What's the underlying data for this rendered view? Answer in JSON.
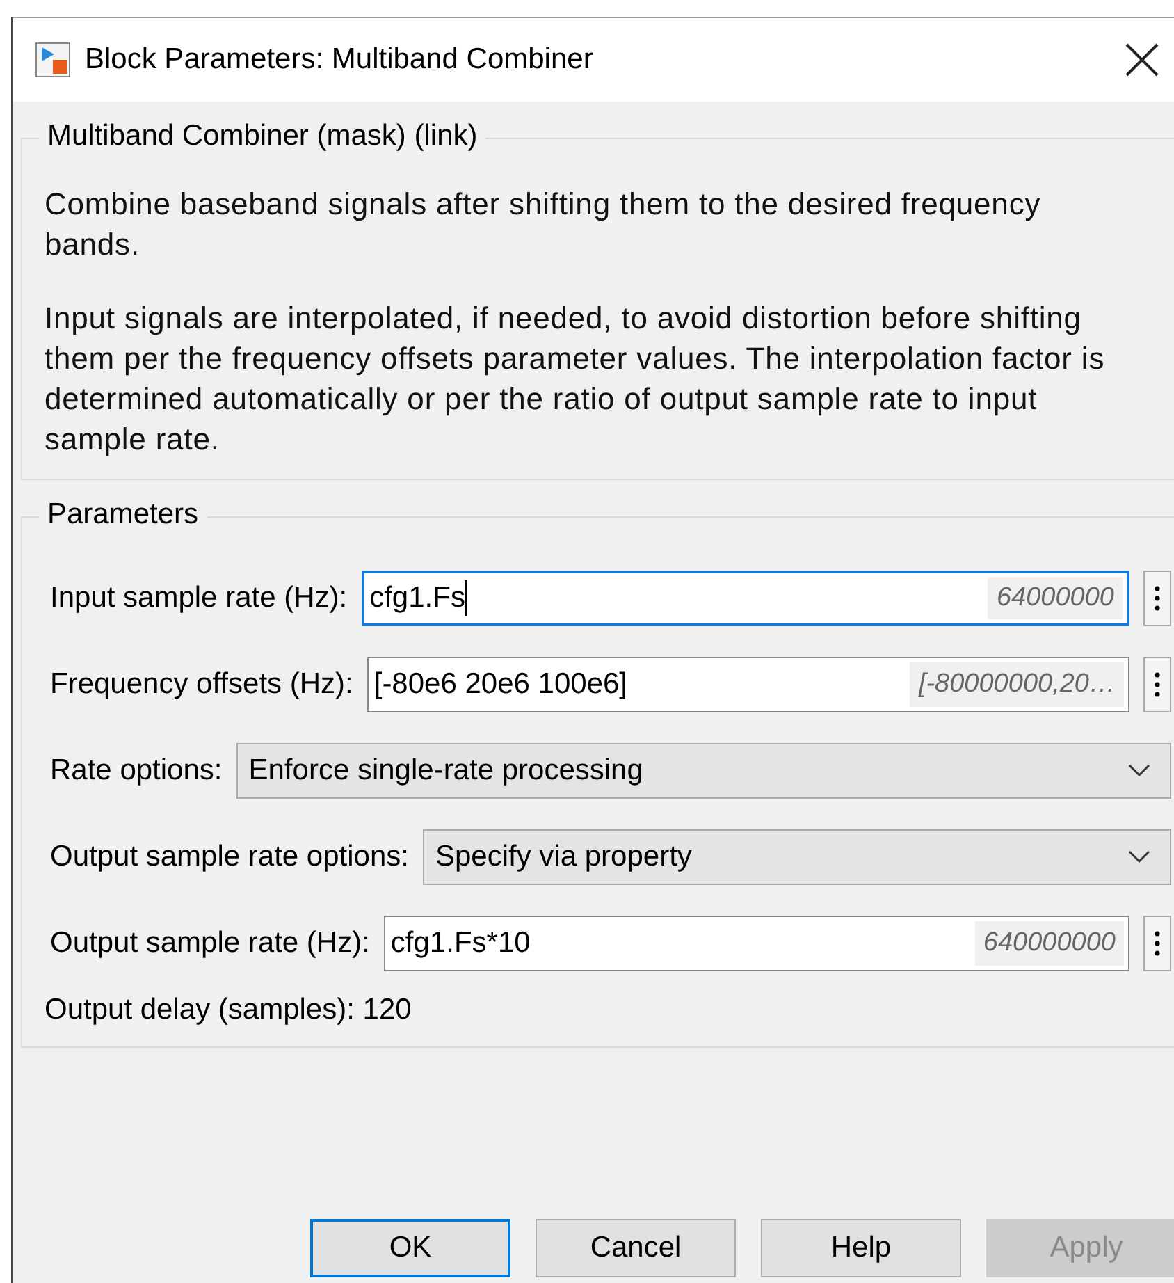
{
  "window": {
    "title": "Block Parameters: Multiband Combiner"
  },
  "description": {
    "title": "Multiband Combiner (mask) (link)",
    "paragraphs": [
      "Combine baseband signals after shifting them to the desired frequency bands.",
      "Input signals are interpolated, if needed, to avoid distortion before shifting them per the frequency offsets parameter values. The interpolation factor is determined automatically or per the ratio of output sample rate to input sample rate."
    ]
  },
  "parameters": {
    "title": "Parameters",
    "rows": [
      {
        "kind": "edit",
        "label": "Input sample rate (Hz):",
        "value": "cfg1.Fs",
        "evaluated": "64000000",
        "focused": true
      },
      {
        "kind": "edit",
        "label": "Frequency offsets (Hz):",
        "value": "[-80e6 20e6 100e6]",
        "evaluated": "[-80000000,20…",
        "focused": false
      },
      {
        "kind": "popup",
        "label": "Rate options:",
        "value": "Enforce single-rate processing"
      },
      {
        "kind": "popup",
        "label": "Output sample rate options:",
        "value": "Specify via property"
      },
      {
        "kind": "edit",
        "label": "Output sample rate (Hz):",
        "value": "cfg1.Fs*10",
        "evaluated": "640000000",
        "focused": false
      },
      {
        "kind": "text",
        "label": "Output delay (samples): 120"
      }
    ]
  },
  "buttons": [
    {
      "label": "OK",
      "default": true,
      "disabled": false
    },
    {
      "label": "Cancel",
      "default": false,
      "disabled": false
    },
    {
      "label": "Help",
      "default": false,
      "disabled": false
    },
    {
      "label": "Apply",
      "default": false,
      "disabled": true
    }
  ]
}
